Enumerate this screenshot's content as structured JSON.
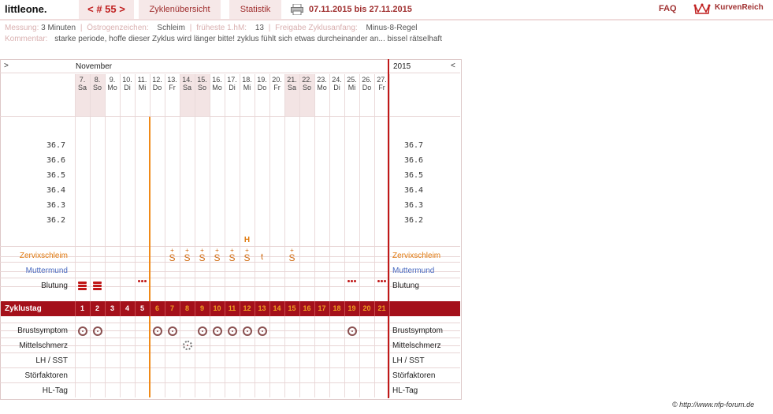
{
  "header": {
    "brand": "littleone.",
    "cycle_tab": "< # 55 >",
    "overview_tab": "Zyklenübersicht",
    "stats_tab": "Statistik",
    "date_range": "07.11.2015 bis 27.11.2015",
    "faq": "FAQ",
    "logo_text": "KurvenReich",
    "accent": "#a03030"
  },
  "meta": {
    "messung_label": "Messung:",
    "messung_value": "3 Minuten",
    "oestrogen_label": "Östrogenzeichen:",
    "oestrogen_value": "Schleim",
    "hm_label": "früheste 1.hM:",
    "hm_value": "13",
    "freigabe_label": "Freigabe Zyklusanfang:",
    "freigabe_value": "Minus-8-Regel",
    "comment_label": "Kommentar:",
    "comment_value": "starke periode, hoffe dieser Zyklus wird länger bitte! zyklus fühlt sich etwas durcheinander an... bissel rätselhaft"
  },
  "chart_data": {
    "type": "table",
    "month_label": "November",
    "year_label": "2015",
    "nav_left": ">",
    "nav_right": "<",
    "days": [
      {
        "date": "7.",
        "wd": "Sa"
      },
      {
        "date": "8.",
        "wd": "So"
      },
      {
        "date": "9.",
        "wd": "Mo"
      },
      {
        "date": "10.",
        "wd": "Di"
      },
      {
        "date": "11.",
        "wd": "Mi"
      },
      {
        "date": "12.",
        "wd": "Do"
      },
      {
        "date": "13.",
        "wd": "Fr"
      },
      {
        "date": "14.",
        "wd": "Sa"
      },
      {
        "date": "15.",
        "wd": "So"
      },
      {
        "date": "16.",
        "wd": "Mo"
      },
      {
        "date": "17.",
        "wd": "Di"
      },
      {
        "date": "18.",
        "wd": "Mi"
      },
      {
        "date": "19.",
        "wd": "Do"
      },
      {
        "date": "20.",
        "wd": "Fr"
      },
      {
        "date": "21.",
        "wd": "Sa"
      },
      {
        "date": "22.",
        "wd": "So"
      },
      {
        "date": "23.",
        "wd": "Mo"
      },
      {
        "date": "24.",
        "wd": "Di"
      },
      {
        "date": "25.",
        "wd": "Mi"
      },
      {
        "date": "26.",
        "wd": "Do"
      },
      {
        "date": "27.",
        "wd": "Fr"
      }
    ],
    "temperature_ticks": [
      "36.7",
      "36.6",
      "36.5",
      "36.4",
      "36.3",
      "36.2"
    ],
    "cycle_day_label": "Zyklustag",
    "cycle_days": [
      "1",
      "2",
      "3",
      "4",
      "5",
      "6",
      "7",
      "8",
      "9",
      "10",
      "11",
      "12",
      "13",
      "14",
      "15",
      "16",
      "17",
      "18",
      "19",
      "20",
      "21"
    ],
    "rows": {
      "zervix": {
        "label": "Zervixschleim",
        "color": "#e07a10",
        "marks": {
          "7": "S+",
          "8": "S+",
          "9": "S+",
          "10": "S+",
          "11": "S+",
          "12": "S+",
          "13": "t",
          "15": "S+"
        },
        "peak_marker": {
          "day": "12",
          "text": "H"
        }
      },
      "muttermund": {
        "label": "Muttermund",
        "color": "#4a6ac0"
      },
      "blutung": {
        "label": "Blutung",
        "bleed_days": [
          "1",
          "2"
        ],
        "spotting_days": [
          "5",
          "19",
          "21"
        ]
      },
      "brust": {
        "label": "Brustsymptom",
        "days": [
          "1",
          "2",
          "6",
          "7",
          "9",
          "10",
          "11",
          "12",
          "13",
          "19"
        ]
      },
      "mittel": {
        "label": "Mittelschmerz",
        "days": [
          "8"
        ]
      },
      "lh": {
        "label": "LH / SST"
      },
      "stoer": {
        "label": "Störfaktoren"
      },
      "hl": {
        "label": "HL-Tag"
      }
    },
    "coverline_after_cycle_day": "5"
  },
  "footer": {
    "copyright": "© http://www.nfp-forum.de",
    "cut_label": "Störfaktoren"
  }
}
